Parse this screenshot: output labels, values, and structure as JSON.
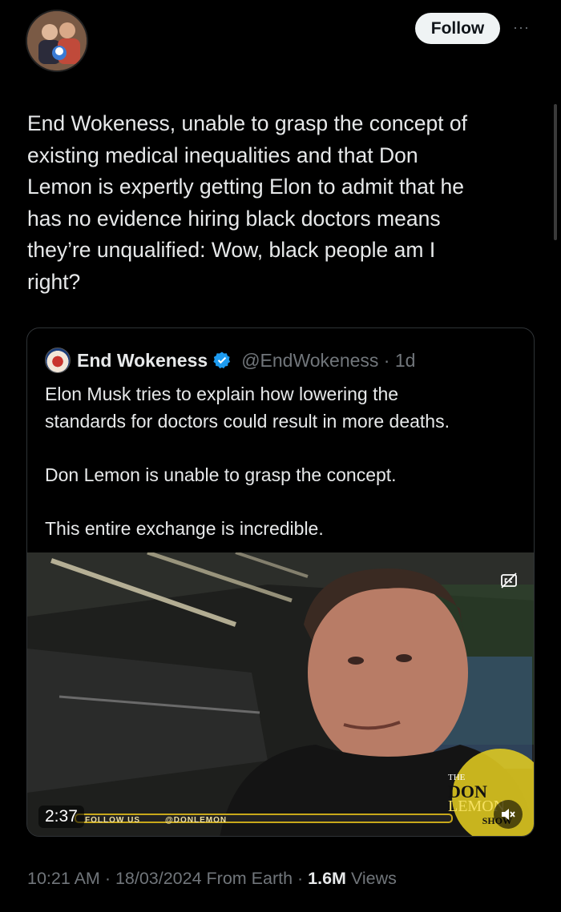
{
  "header": {
    "follow_label": "Follow",
    "more_label": "···"
  },
  "tweet": {
    "text": "End Wokeness, unable to grasp the concept of\nexisting medical inequalities and that Don\nLemon is expertly getting Elon to admit that he\nhas no evidence hiring black doctors means\nthey’re unqualified: Wow, black people am I\nright?"
  },
  "quote": {
    "name": "End Wokeness",
    "handle_time": "@EndWokeness · 1d",
    "body": "Elon Musk tries to explain how lowering the\nstandards for doctors could result in more deaths.\n\nDon Lemon is unable to grasp the concept.\n\nThis entire exchange is incredible.",
    "video": {
      "duration": "2:37",
      "overlay_text": "FOLLOW US",
      "overlay_handle": "@DONLEMON",
      "logo_the": "THE",
      "logo_don": "DON",
      "logo_lemon": "LEMON",
      "logo_show": "SHOW"
    }
  },
  "meta": {
    "time_date": "10:21 AM · 18/03/2024 From Earth · ",
    "views_count": "1.6M",
    "views_label": " Views"
  },
  "colors": {
    "background": "#000000",
    "text": "#e7e9ea",
    "muted": "#71767b",
    "verified": "#1d9bf0"
  }
}
